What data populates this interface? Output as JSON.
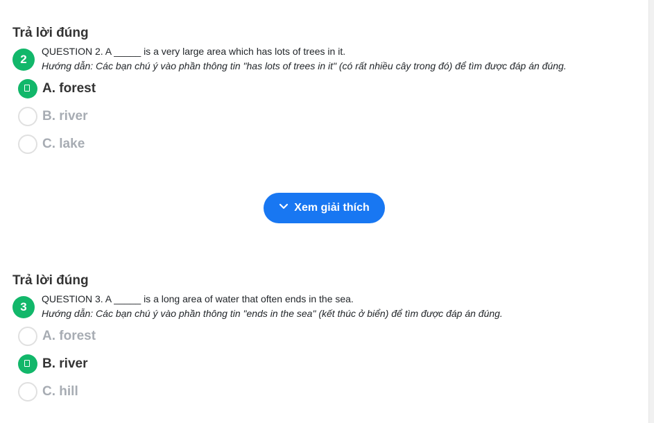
{
  "questions": [
    {
      "status": "Trả lời đúng",
      "number": "2",
      "text": "QUESTION 2. A _____ is a very large area which has lots of trees in it.",
      "hint": "Hướng dẫn: Các bạn chú ý vào phần thông tin \"has lots of trees in it\" (có rất nhiều cây trong đó) để tìm được đáp án đúng.",
      "options": [
        {
          "label": "A. forest",
          "correct": true
        },
        {
          "label": "B. river",
          "correct": false
        },
        {
          "label": "C. lake",
          "correct": false
        }
      ]
    },
    {
      "status": "Trả lời đúng",
      "number": "3",
      "text": "QUESTION 3. A _____ is a long area of water that often ends in the sea.",
      "hint": "Hướng dẫn: Các bạn chú ý vào phần thông tin \"ends in the sea\" (kết thúc ở biển) để tìm được đáp án đúng.",
      "options": [
        {
          "label": "A. forest",
          "correct": false
        },
        {
          "label": "B. river",
          "correct": true
        },
        {
          "label": "C. hill",
          "correct": false
        }
      ]
    }
  ],
  "explain_button": {
    "label": "Xem giải thích",
    "icon": "chevron-down-icon"
  },
  "colors": {
    "correct_green": "#12b76a",
    "button_blue": "#1877f2",
    "muted_option": "#a7acb3",
    "radio_border": "#e0e0e0"
  }
}
